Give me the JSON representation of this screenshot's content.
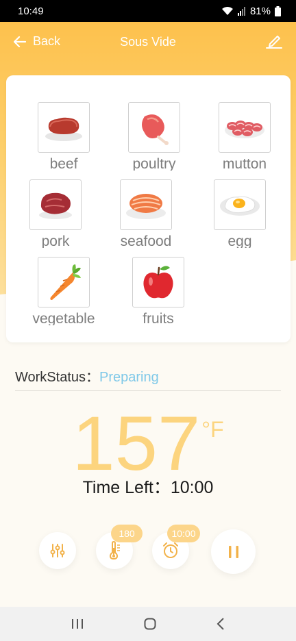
{
  "status_bar": {
    "time": "10:49",
    "battery": "81%"
  },
  "app_bar": {
    "back_label": "Back",
    "title": "Sous Vide"
  },
  "foods": [
    {
      "label": "beef",
      "icon": "beef-icon"
    },
    {
      "label": "poultry",
      "icon": "poultry-icon"
    },
    {
      "label": "mutton",
      "icon": "mutton-icon"
    },
    {
      "label": "pork",
      "icon": "pork-icon"
    },
    {
      "label": "seafood",
      "icon": "seafood-icon"
    },
    {
      "label": "egg",
      "icon": "egg-icon"
    },
    {
      "label": "vegetable",
      "icon": "vegetable-icon"
    },
    {
      "label": "fruits",
      "icon": "fruits-icon"
    }
  ],
  "work_status": {
    "label": "WorkStatus：",
    "value": "Preparing"
  },
  "temperature": {
    "value": "157",
    "unit": "°F"
  },
  "time_left": {
    "label": "Time Left：",
    "value": "10:00"
  },
  "controls": {
    "temp_badge": "180",
    "timer_badge": "10:00"
  },
  "colors": {
    "accent": "#fcc14d",
    "status": "#7ec8e8",
    "temp": "#fcd47e"
  }
}
